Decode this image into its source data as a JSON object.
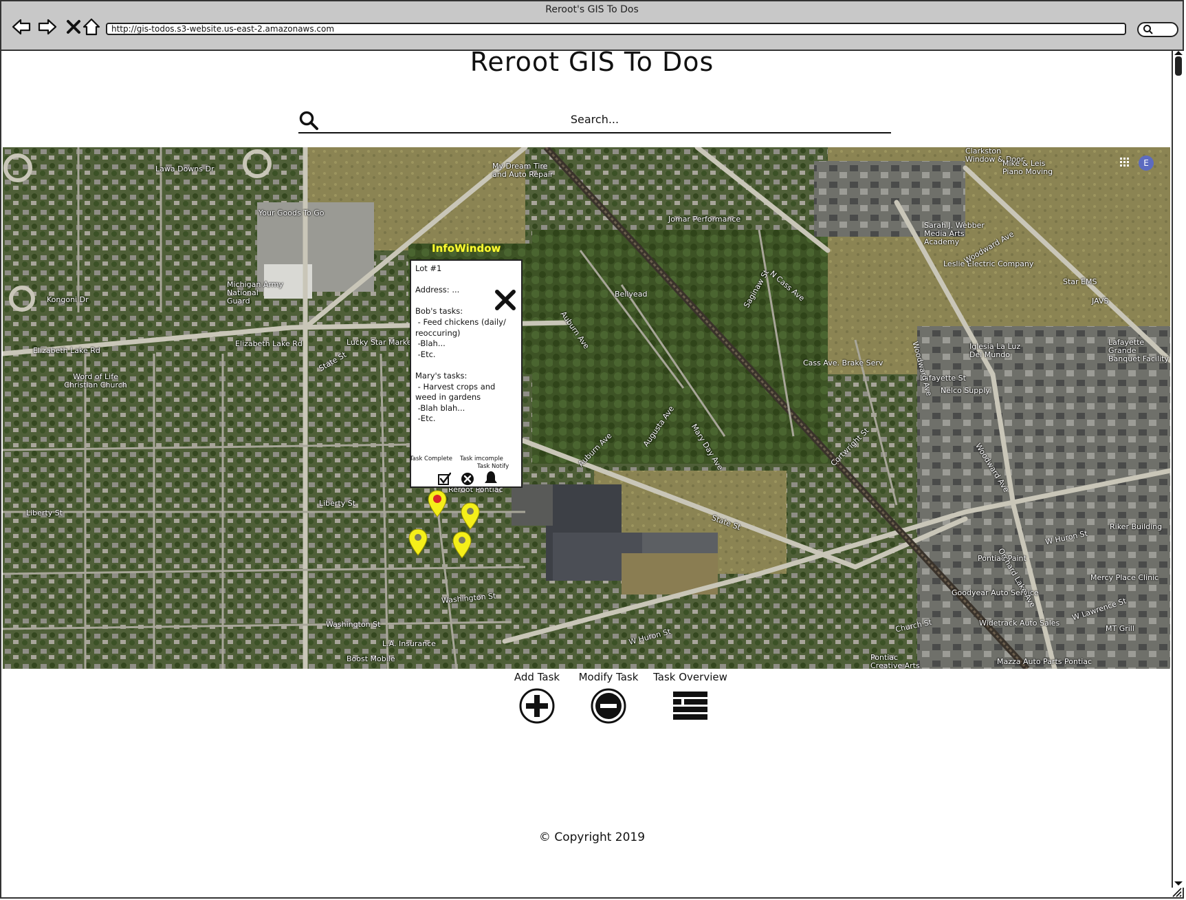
{
  "browser": {
    "window_title": "Reroot's GIS To Dos",
    "url": "http://gis-todos.s3-website.us-east-2.amazonaws.com"
  },
  "page": {
    "title": "Reroot GIS To Dos",
    "search_placeholder": "Search..."
  },
  "map": {
    "labels": [
      "Clarkston Window & Door",
      "My Dream Tire and Auto Repair",
      "Mike & Leis Piano Moving",
      "Your Goods To Go",
      "Jomar Performance",
      "Sarah J. Webber Media Arts Academy",
      "Leslie Electric Company",
      "Michigan Army National Guard",
      "Bellyead",
      "Star EMS",
      "JAVS",
      "Lucky Star Market",
      "Elizabeth Lake Rd",
      "Iglesia La Luz Del Mundo",
      "Lafayette Grande Banquet Facility",
      "Word of Life Christian Church",
      "Cass Ave. Brake Serv",
      "Lafayette St",
      "Nelco Supply",
      "Reroot Pontiac",
      "Riker Building",
      "Pontiac Paint",
      "Goodyear Auto Service",
      "Mercy Place Clinic",
      "Widetrack Auto Sales",
      "MT Grill",
      "L.A. Insurance",
      "Boost Mobile",
      "Pontiac Creative Arts Center",
      "Mazza Auto Parts Pontiac",
      "W Huron St",
      "State St",
      "Liberty St",
      "Washington St",
      "Woodward Ave",
      "N Cass Ave",
      "Saginaw St",
      "Kongoni Dr",
      "Lawa Downs Dr",
      "Elizabeth Lake Rd",
      "Church St",
      "W Lawrence St",
      "Orchard Lake Ave",
      "Auburn Ave",
      "Augusta Ave",
      "Mary Day Ave",
      "Cortwright St",
      "Auburn Ave"
    ],
    "avatar_letter": "E"
  },
  "info_window": {
    "title": "InfoWindow",
    "body": "Lot #1\n\nAddress: ...\n\nBob's tasks:\n - Feed chickens (daily/\nreoccuring)\n -Blah...\n -Etc.\n\nMary's tasks:\n - Harvest crops and\nweed in gardens\n -Blah blah...\n -Etc.",
    "task_complete_label": "Task Complete",
    "task_incomplete_label": "Task imcomple",
    "task_notify_label": "Task Notify"
  },
  "actions": {
    "add_label": "Add Task",
    "modify_label": "Modify Task",
    "overview_label": "Task Overview"
  },
  "footer": {
    "copyright": "© Copyright 2019"
  },
  "colors": {
    "pin_yellow": "#f5ef1a",
    "pin_red_dot": "#d8262a",
    "infowindow_title": "#ffff33",
    "chrome_bg": "#c8c8c8"
  }
}
